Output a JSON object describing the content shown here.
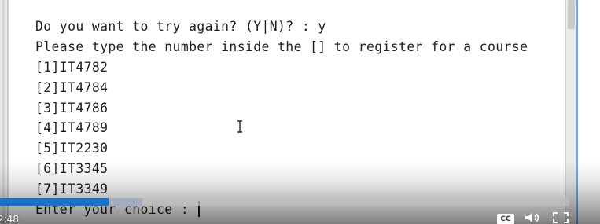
{
  "console": {
    "lines": {
      "l0": "Do you want to try again? (Y|N)? : y",
      "l1": "Please type the number inside the [] to register for a course",
      "l2": "[1]IT4782",
      "l3": "[2]IT4784",
      "l4": "[3]IT4786",
      "l5": "[4]IT4789",
      "l6": "[5]IT2230",
      "l7": "[6]IT3345",
      "l8": "[7]IT3349",
      "l9": "Enter your choice :"
    }
  },
  "video_player": {
    "elapsed_time": "2:48",
    "progress_fraction": 0.19,
    "buffered_fraction": 0.06,
    "captions_label": "CC",
    "accent_color": "#1a73c8"
  },
  "icons": {
    "cursor": "text-cursor-icon",
    "volume": "volume-icon",
    "fullscreen": "fullscreen-icon"
  }
}
